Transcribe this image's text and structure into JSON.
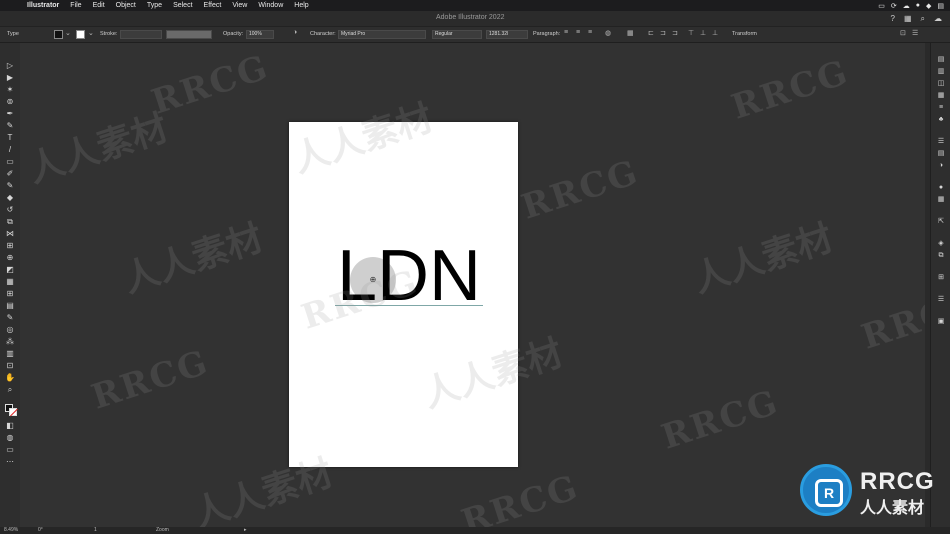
{
  "menubar": {
    "app_name": "Illustrator",
    "items": [
      "File",
      "Edit",
      "Object",
      "Type",
      "Select",
      "Effect",
      "View",
      "Window",
      "Help"
    ],
    "status_icons": [
      "video-icon",
      "sync-icon",
      "cloud-icon",
      "record-icon",
      "dropbox-icon",
      "control-icon"
    ]
  },
  "appbar": {
    "title": "Adobe Illustrator 2022"
  },
  "controlbar": {
    "type_label": "Type",
    "stroke_label": "Stroke:",
    "opacity_label": "Opacity:",
    "opacity_value": "100%",
    "character_label": "Character:",
    "font_family": "Myriad Pro",
    "font_style": "Regular",
    "font_size": "1281.32l",
    "paragraph_label": "Paragraph:",
    "transform_label": "Transform"
  },
  "artboard": {
    "text": "LDN"
  },
  "statusbar": {
    "zoom": "8.49%",
    "rotation": "0°",
    "artboard_number": "1",
    "tool_name": "Zoom"
  },
  "watermarks": {
    "latin": "RRCG",
    "cjk": "人人素材"
  },
  "brand": {
    "name": "RRCG",
    "sub": "人人素材"
  },
  "colors": {
    "ui_background": "#323232",
    "panel": "#2e2e2e",
    "brand_blue": "#1d7fc4"
  }
}
